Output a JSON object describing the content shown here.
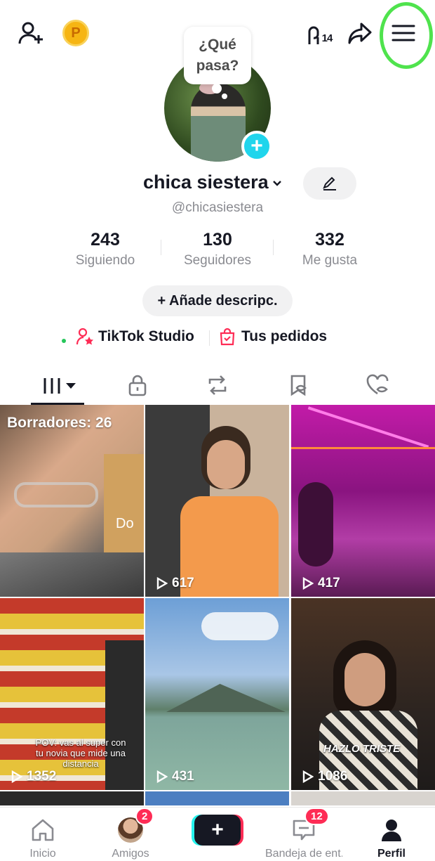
{
  "topbar": {
    "coin_letter": "P",
    "hashtag_count": "14"
  },
  "profile": {
    "bubble_text": "¿Qué pasa?",
    "display_name": "chica siestera",
    "username": "@chicasiestera",
    "stats": [
      {
        "value": "243",
        "label": "Siguiendo"
      },
      {
        "value": "130",
        "label": "Seguidores"
      },
      {
        "value": "332",
        "label": "Me gusta"
      }
    ],
    "add_description": "+ Añade descripc.",
    "studio_link": "TikTok Studio",
    "orders_link": "Tus pedidos"
  },
  "tabs": [
    {
      "icon": "videos-grid-icon",
      "active": true
    },
    {
      "icon": "lock-icon",
      "active": false
    },
    {
      "icon": "repost-icon",
      "active": false
    },
    {
      "icon": "saved-icon",
      "active": false
    },
    {
      "icon": "liked-icon",
      "active": false
    }
  ],
  "grid": {
    "drafts_label": "Borradores: 26",
    "drafts_overlay": "Do",
    "videos": [
      {
        "views": "617"
      },
      {
        "views": "417"
      },
      {
        "views": "1352",
        "caption": "POV: vas al super con tu novia que mide una distancia"
      },
      {
        "views": "431"
      },
      {
        "views": "1086",
        "caption": "HAZLO TRISTE"
      }
    ]
  },
  "bottom_nav": {
    "home": "Inicio",
    "friends": "Amigos",
    "friends_badge": "2",
    "inbox": "Bandeja de ent...",
    "inbox_badge": "12",
    "profile": "Perfil"
  },
  "colors": {
    "accent_cyan": "#20d5ec",
    "badge_red": "#fe2c55",
    "highlight_green": "#4fe34d"
  }
}
